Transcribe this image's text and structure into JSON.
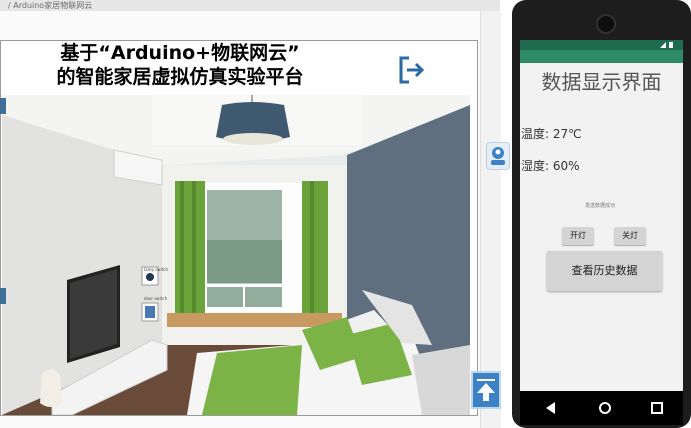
{
  "browser": {
    "tab_title": "/ Arduino家居物联网云"
  },
  "header": {
    "title_line1": "基于“Arduino+物联网云”",
    "title_line2": "的智能家居虚拟仿真实验平台"
  },
  "scene": {
    "switch_label_top": "lamp switch",
    "switch_label_bottom": "door switch"
  },
  "phone": {
    "app_title": "数据显示界面",
    "temperature_text": "温度: 27℃",
    "humidity_text": "湿度: 60%",
    "status_text": "发送数据成功",
    "on_button_label": "开灯",
    "off_button_label": "关灯",
    "history_button_label": "查看历史数据",
    "statusbar_color": "#1f6b4f",
    "appbar_color": "#2d8c67"
  },
  "colors": {
    "accent_blue": "#3d82c4",
    "wall_blue": "#5f6f80",
    "curtain_green": "#6aa33a"
  }
}
